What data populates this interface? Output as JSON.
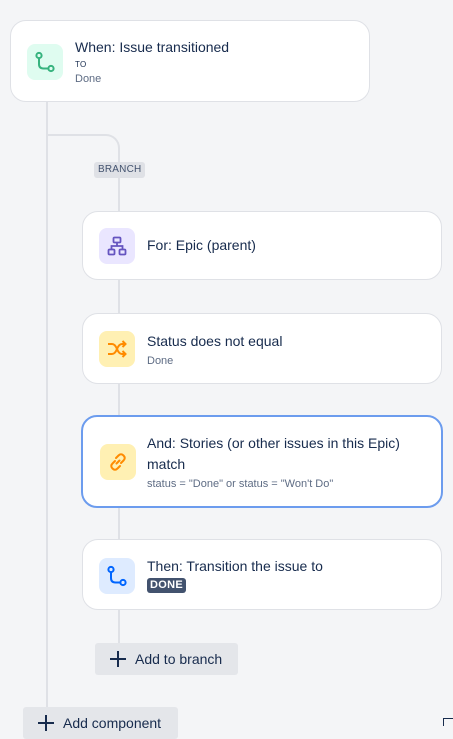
{
  "colors": {
    "trigger_icon_bg": "#dffcf0",
    "trigger_icon": "#36b37e",
    "branch_icon_bg": "#eae6ff",
    "branch_icon": "#6554c0",
    "condition_icon_bg": "#fff0b3",
    "condition_icon": "#ff8b00",
    "action_icon_bg": "#deebff",
    "action_icon": "#0065ff",
    "selected_border": "#6c9cee"
  },
  "trigger": {
    "icon": "transition-icon",
    "title": "When: Issue transitioned",
    "to_label": "TO",
    "status": "Done"
  },
  "branch": {
    "tag": "BRANCH",
    "for_card": {
      "icon": "hierarchy-icon",
      "title": "For: Epic (parent)"
    },
    "condition_card": {
      "icon": "shuffle-icon",
      "title": "Status does not equal",
      "value": "Done"
    },
    "related_card": {
      "icon": "link-icon",
      "title_line1": "And: Stories (or other issues in this Epic)",
      "title_line2": "match",
      "jql": "status = \"Done\" or status = \"Won't Do\""
    },
    "action_card": {
      "icon": "transition-icon",
      "title": "Then: Transition the issue to",
      "status_lozenge": "DONE"
    },
    "add_to_branch_label": "Add to branch"
  },
  "add_component_label": "Add component"
}
